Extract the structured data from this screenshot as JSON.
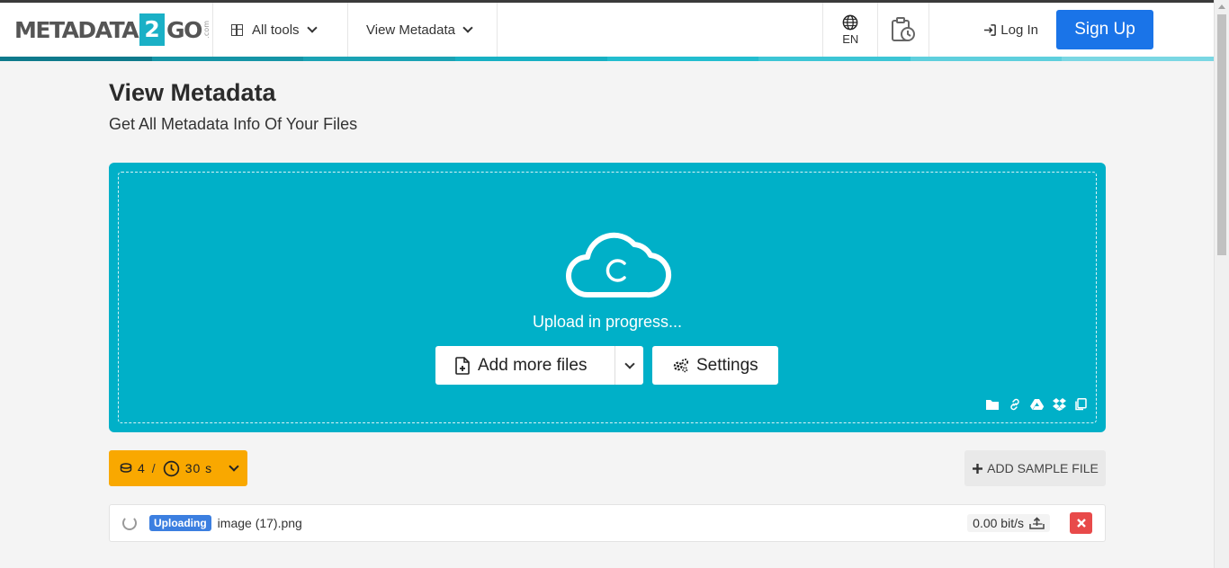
{
  "brand": {
    "logo_left": "METADATA",
    "logo_digit": "2",
    "logo_right": "GO",
    "logo_suffix": ".com"
  },
  "nav": {
    "all_tools": "All tools",
    "current_tool": "View Metadata",
    "language": "EN",
    "login": "Log In",
    "signup": "Sign Up"
  },
  "colorbar": [
    "#0e7a8c",
    "#1594a6",
    "#1aa2b4",
    "#17b0c3",
    "#22bdcf",
    "#3cc5d5",
    "#5ecfdd",
    "#7ad7e3"
  ],
  "page": {
    "title": "View Metadata",
    "subtitle": "Get All Metadata Info Of Your Files"
  },
  "upload": {
    "status": "Upload in progress...",
    "add_files": "Add more files",
    "settings": "Settings",
    "sources": [
      "folder-icon",
      "link-icon",
      "google-drive-icon",
      "dropbox-icon",
      "clipboard-icon"
    ]
  },
  "credits": {
    "count": "4",
    "separator": "/",
    "time": "30 s"
  },
  "sample_button": "ADD SAMPLE FILE",
  "files": [
    {
      "status": "Uploading",
      "name": "image (17).png",
      "speed": "0.00 bit/s"
    }
  ],
  "colors": {
    "accent": "#00b0c8",
    "signup": "#1a74e8",
    "credits": "#f9a800",
    "badge": "#3c7fe0",
    "remove": "#e84a4a"
  }
}
